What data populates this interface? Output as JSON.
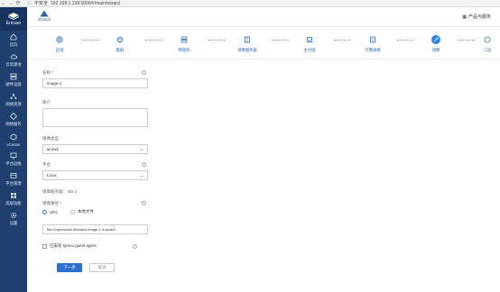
{
  "browser": {
    "back": "←",
    "forward": "→",
    "reload": "⟳",
    "security_label": "不安全",
    "url": "192.168.1.159:5000/#/main/wizard"
  },
  "sidebar": {
    "logo_label": "Ericsso",
    "items": [
      {
        "label": "首页",
        "icon": "home-icon"
      },
      {
        "label": "云资源池",
        "icon": "cloud-icon"
      },
      {
        "label": "硬件设施",
        "icon": "server-icon"
      },
      {
        "label": "网络资源",
        "icon": "network-icon"
      },
      {
        "label": "网络服务",
        "icon": "service-icon"
      },
      {
        "label": "vCenter",
        "icon": "vcenter-icon"
      },
      {
        "label": "平台运维",
        "icon": "monitor-icon"
      },
      {
        "label": "平台管理",
        "icon": "manage-icon"
      },
      {
        "label": "高级功能",
        "icon": "advanced-icon"
      },
      {
        "label": "设置",
        "icon": "gear-icon"
      }
    ]
  },
  "topbar": {
    "brand": "ZStack",
    "product_link": "产品与服务"
  },
  "wizard": {
    "steps": [
      {
        "label": "区域",
        "icon": "zone-icon"
      },
      {
        "label": "集群",
        "icon": "cluster-icon"
      },
      {
        "label": "物理机",
        "icon": "host-icon"
      },
      {
        "label": "镜像服务器",
        "icon": "backup-storage-icon"
      },
      {
        "label": "主存储",
        "icon": "primary-storage-icon"
      },
      {
        "label": "计算规格",
        "icon": "instance-offering-icon"
      },
      {
        "label": "镜像",
        "icon": "image-icon"
      },
      {
        "label": "二层",
        "icon": "l2-network-icon"
      }
    ],
    "active_step": "镜像"
  },
  "form": {
    "name_label": "名称 *",
    "name_value": "image-1",
    "desc_label": "简介",
    "type_label": "镜像类型",
    "type_value": "qcow2",
    "platform_label": "平台",
    "platform_value": "Linux",
    "backup_label": "镜像服务器：",
    "backup_value": "BS-1",
    "path_label": "镜像路径 *",
    "radio_url": "URL",
    "radio_local": "本地文件",
    "path_value": "file:///opt/zstack-iii/zstack-image-1.4.qcow2",
    "agent_label": "已安装 Qemu guest agent",
    "next_button": "下一步",
    "cancel_button": "取消"
  }
}
